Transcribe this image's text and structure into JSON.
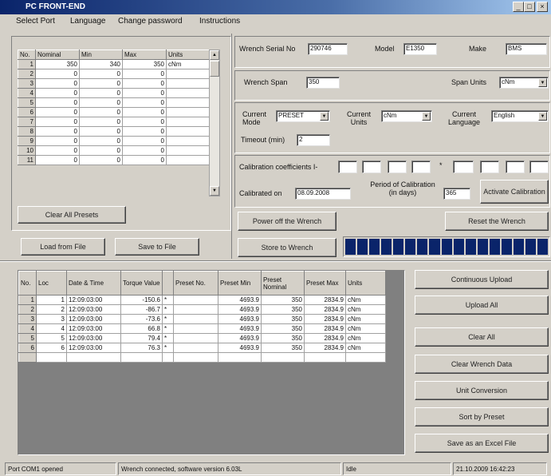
{
  "window": {
    "title": "PC FRONT-END",
    "minimize": "_",
    "restore": "□",
    "close": "×"
  },
  "menu": [
    "Select Port",
    "Language",
    "Change password",
    "Instructions"
  ],
  "presets": {
    "headers": [
      "No.",
      "Nominal",
      "Min",
      "Max",
      "Units"
    ],
    "rows": [
      [
        "1",
        "350",
        "340",
        "350",
        "cNm"
      ],
      [
        "2",
        "0",
        "0",
        "0",
        ""
      ],
      [
        "3",
        "0",
        "0",
        "0",
        ""
      ],
      [
        "4",
        "0",
        "0",
        "0",
        ""
      ],
      [
        "5",
        "0",
        "0",
        "0",
        ""
      ],
      [
        "6",
        "0",
        "0",
        "0",
        ""
      ],
      [
        "7",
        "0",
        "0",
        "0",
        ""
      ],
      [
        "8",
        "0",
        "0",
        "0",
        ""
      ],
      [
        "9",
        "0",
        "0",
        "0",
        ""
      ],
      [
        "10",
        "0",
        "0",
        "0",
        ""
      ],
      [
        "11",
        "0",
        "0",
        "0",
        ""
      ]
    ],
    "clear_all_label": "Clear All Presets"
  },
  "wrench": {
    "serial_label": "Wrench Serial No",
    "serial_value": "290746",
    "model_label": "Model",
    "model_value": "E1350",
    "make_label": "Make",
    "make_value": "BMS",
    "span_label": "Wrench Span",
    "span_value": "350",
    "span_units_label": "Span Units",
    "span_units_value": "cNm",
    "mode_label": "Current Mode",
    "mode_value": "PRESET",
    "units_label": "Current Units",
    "units_value": "cNm",
    "language_label": "Current Language",
    "language_value": "English",
    "timeout_label": "Timeout (min)",
    "timeout_value": "2",
    "calib_coeff_label": "Calibration coefficients I-",
    "calib_coeff_star": "*",
    "calibrated_on_label": "Calibrated on",
    "calibrated_on_value": "08.09.2008",
    "period_label": "Period of Calibration (in days)",
    "period_value": "365",
    "activate_label": "Activate Calibration",
    "power_off_label": "Power off the Wrench",
    "reset_label": "Reset the Wrench",
    "store_label": "Store to Wrench",
    "progress_blocks": 17
  },
  "file": {
    "load_label": "Load from File",
    "save_label": "Save to File"
  },
  "readings": {
    "headers": [
      "No.",
      "Loc",
      "Date & Time",
      "Torque Value",
      "",
      "Preset No.",
      "Preset Min",
      "Preset Nominal",
      "Preset Max",
      "Units"
    ],
    "rows": [
      [
        "1",
        "1",
        "12:09:03:00",
        "-150.6",
        "*",
        "",
        "4693.9",
        "350",
        "2834.9",
        "cNm"
      ],
      [
        "2",
        "2",
        "12:09:03:00",
        "-86.7",
        "*",
        "",
        "4693.9",
        "350",
        "2834.9",
        "cNm"
      ],
      [
        "3",
        "3",
        "12:09:03:00",
        "-73.6",
        "*",
        "",
        "4693.9",
        "350",
        "2834.9",
        "cNm"
      ],
      [
        "4",
        "4",
        "12:09:03:00",
        "66.8",
        "*",
        "",
        "4693.9",
        "350",
        "2834.9",
        "cNm"
      ],
      [
        "5",
        "5",
        "12:09:03:00",
        "79.4",
        "*",
        "",
        "4693.9",
        "350",
        "2834.9",
        "cNm"
      ],
      [
        "6",
        "6",
        "12:09:03:00",
        "76.3",
        "*",
        "",
        "4693.9",
        "350",
        "2834.9",
        "cNm"
      ]
    ]
  },
  "actions": [
    "Continuous Upload",
    "Upload All",
    "Clear All",
    "Clear Wrench Data",
    "Unit Conversion",
    "Sort by Preset",
    "Save as an Excel File"
  ],
  "status": {
    "port": "Port COM1 opened",
    "wrench": "Wrench connected, software version 6.03L",
    "state": "Idle",
    "datetime": "21.10.2009 16:42:23"
  }
}
